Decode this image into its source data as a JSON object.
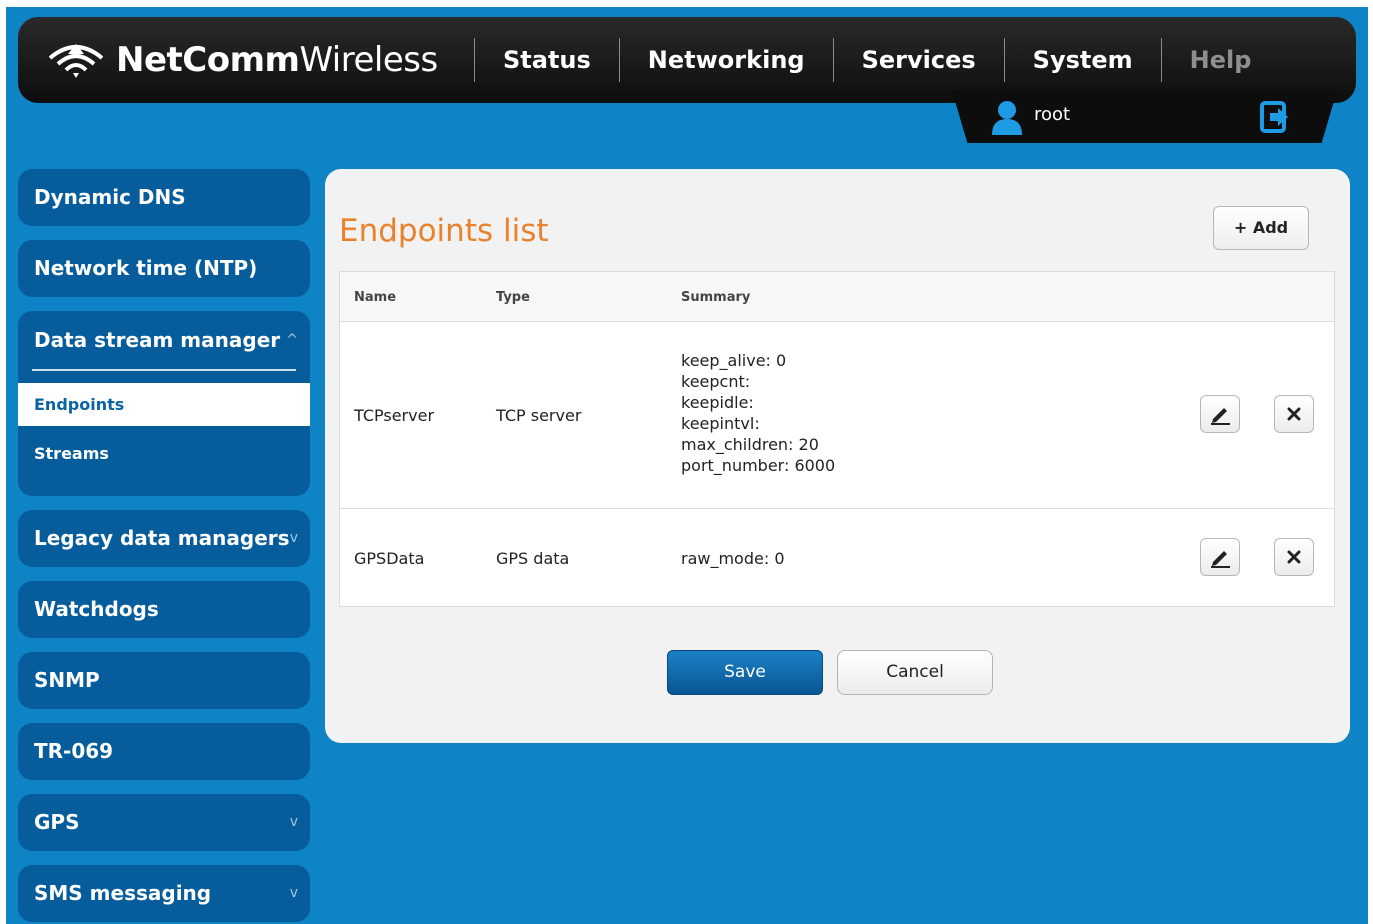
{
  "brand": {
    "bold": "NetComm",
    "light": "Wireless"
  },
  "nav": {
    "items": [
      {
        "label": "Status"
      },
      {
        "label": "Networking"
      },
      {
        "label": "Services"
      },
      {
        "label": "System"
      },
      {
        "label": "Help"
      }
    ]
  },
  "user": {
    "name": "root"
  },
  "sidebar": {
    "items_top": [
      {
        "label": "Dynamic DNS"
      },
      {
        "label": "Network time (NTP)"
      }
    ],
    "group": {
      "label": "Data stream manager",
      "chevron": "^",
      "subitems": [
        {
          "label": "Endpoints",
          "active": true
        },
        {
          "label": "Streams",
          "active": false
        }
      ]
    },
    "items_bottom": [
      {
        "label": "Legacy data managers",
        "chevron": "v"
      },
      {
        "label": "Watchdogs"
      },
      {
        "label": "SNMP"
      },
      {
        "label": "TR-069"
      },
      {
        "label": "GPS",
        "chevron": "v"
      },
      {
        "label": "SMS messaging",
        "chevron": "v"
      }
    ]
  },
  "main": {
    "title": "Endpoints list",
    "add_label": "+ Add",
    "columns": [
      "Name",
      "Type",
      "Summary"
    ],
    "rows": [
      {
        "name": "TCPserver",
        "type": "TCP server",
        "summary": [
          "keep_alive: 0",
          "keepcnt:",
          "keepidle:",
          "keepintvl:",
          "max_children: 20",
          "port_number: 6000"
        ]
      },
      {
        "name": "GPSData",
        "type": "GPS data",
        "summary": [
          "raw_mode: 0"
        ]
      }
    ],
    "save_label": "Save",
    "cancel_label": "Cancel"
  },
  "colors": {
    "background": "#0e84c6",
    "sidebar": "#075d9c",
    "accent_title": "#e8822b",
    "primary_button": "#0a5693"
  },
  "icons": [
    "wifi-logo-icon",
    "user-icon",
    "logout-icon",
    "edit-icon",
    "delete-icon",
    "chevron-up-icon",
    "chevron-down-icon"
  ]
}
